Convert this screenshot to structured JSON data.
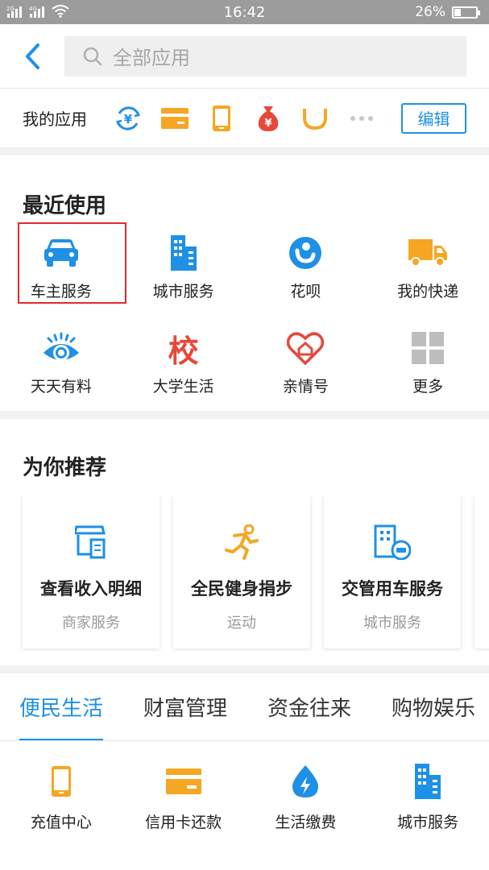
{
  "status": {
    "signal_left": "2G",
    "signal_right": "4G",
    "time": "16:42",
    "battery": "26%"
  },
  "search": {
    "placeholder": "全部应用"
  },
  "my_apps": {
    "label": "我的应用",
    "edit_label": "编辑",
    "icons": [
      "yuan-refresh-icon",
      "card-icon",
      "phone-icon",
      "money-bag-icon",
      "cup-icon",
      "more-dots-icon"
    ]
  },
  "recent": {
    "title": "最近使用",
    "items": [
      {
        "label": "车主服务",
        "icon": "car-icon",
        "color": "#1e90e6"
      },
      {
        "label": "城市服务",
        "icon": "city-building-icon",
        "color": "#1e90e6"
      },
      {
        "label": "花呗",
        "icon": "huabei-icon",
        "color": "#1e90e6"
      },
      {
        "label": "我的快递",
        "icon": "truck-icon",
        "color": "#f5a623"
      },
      {
        "label": "天天有料",
        "icon": "eye-icon",
        "color": "#1e90e6"
      },
      {
        "label": "大学生活",
        "icon": "xiao-character-icon",
        "color": "#e8473b",
        "glyph": "校"
      },
      {
        "label": "亲情号",
        "icon": "heart-home-icon",
        "color": "#e8473b"
      },
      {
        "label": "更多",
        "icon": "grid-more-icon",
        "color": "#bdbdbd"
      }
    ]
  },
  "recommend": {
    "title": "为你推荐",
    "cards": [
      {
        "title": "查看收入明细",
        "sub": "商家服务",
        "icon": "store-receipt-icon"
      },
      {
        "title": "全民健身捐步",
        "sub": "运动",
        "icon": "runner-icon"
      },
      {
        "title": "交管用车服务",
        "sub": "城市服务",
        "icon": "building-car-icon"
      }
    ]
  },
  "tabs": [
    {
      "label": "便民生活",
      "active": true
    },
    {
      "label": "财富管理",
      "active": false
    },
    {
      "label": "资金往来",
      "active": false
    },
    {
      "label": "购物娱乐",
      "active": false
    }
  ],
  "services": [
    {
      "label": "充值中心",
      "icon": "phone-icon"
    },
    {
      "label": "信用卡还款",
      "icon": "card-icon"
    },
    {
      "label": "生活缴费",
      "icon": "water-drop-bolt-icon"
    },
    {
      "label": "城市服务",
      "icon": "city-building-icon"
    }
  ],
  "colors": {
    "accent": "#1e90e6",
    "orange": "#f5a623",
    "red": "#e8473b",
    "highlight": "#e02c2c"
  }
}
